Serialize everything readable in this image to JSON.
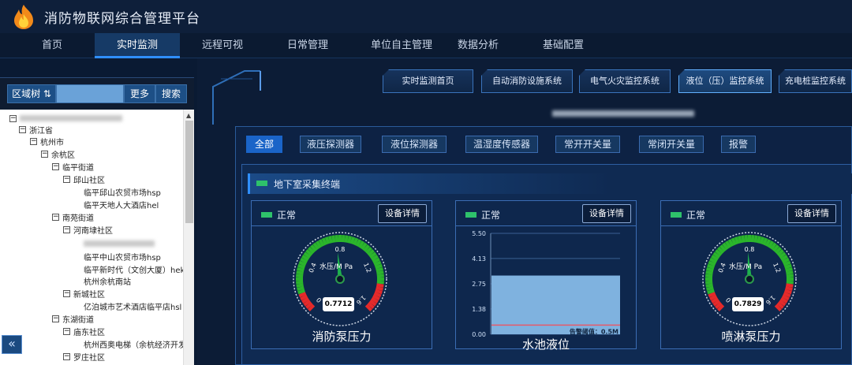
{
  "app": {
    "title": "消防物联网综合管理平台"
  },
  "nav": [
    {
      "label": "首页",
      "active": false
    },
    {
      "label": "实时监测",
      "active": true
    },
    {
      "label": "远程可视",
      "active": false
    },
    {
      "label": "日常管理",
      "active": false
    },
    {
      "label": "单位自主管理",
      "active": false
    },
    {
      "label": "数据分析",
      "active": false
    },
    {
      "label": "基础配置",
      "active": false
    }
  ],
  "tree": {
    "region_button": "区域树 ⇅",
    "more_button": "更多",
    "search_button": "搜索",
    "nodes": [
      {
        "label": "浙江省",
        "level": 1
      },
      {
        "label": "杭州市",
        "level": 2
      },
      {
        "label": "余杭区",
        "level": 3
      },
      {
        "label": "临平街道",
        "level": 4
      },
      {
        "label": "邱山社区",
        "level": 5
      },
      {
        "label": "临平邱山农贸市场hsp",
        "level": 6
      },
      {
        "label": "临平天地人大酒店hel",
        "level": 6
      },
      {
        "label": "南苑街道",
        "level": 4
      },
      {
        "label": "河南埭社区",
        "level": 5
      },
      {
        "label": "临平中山农贸市场hsp",
        "level": 6
      },
      {
        "label": "临平新时代（文创大厦）hek",
        "level": 6
      },
      {
        "label": "杭州余杭南站",
        "level": 6
      },
      {
        "label": "新城社区",
        "level": 5
      },
      {
        "label": "亿泊城市艺术酒店临平店hsl",
        "level": 6
      },
      {
        "label": "东湖街道",
        "level": 4
      },
      {
        "label": "庙东社区",
        "level": 5
      },
      {
        "label": "杭州西奥电梯（余杭经济开发区",
        "level": 6
      },
      {
        "label": "罗庄社区",
        "level": 5
      }
    ]
  },
  "systems": [
    {
      "label": "实时监测首页",
      "active": false
    },
    {
      "label": "自动消防设施系统",
      "active": false
    },
    {
      "label": "电气火灾监控系统",
      "active": false
    },
    {
      "label": "液位（压）监控系统",
      "active": true
    },
    {
      "label": "充电桩监控系统",
      "active": false
    }
  ],
  "filters": [
    {
      "label": "全部",
      "active": true
    },
    {
      "label": "液压探测器",
      "active": false
    },
    {
      "label": "液位探测器",
      "active": false
    },
    {
      "label": "温湿度传感器",
      "active": false
    },
    {
      "label": "常开开关量",
      "active": false
    },
    {
      "label": "常闭开关量",
      "active": false
    },
    {
      "label": "报警",
      "active": false
    }
  ],
  "section": {
    "title": "地下室采集终端"
  },
  "cards": [
    {
      "status": "正常",
      "detail_button": "设备详情",
      "kind": "gauge",
      "value": 0.7712,
      "value_text": "0.7712",
      "unit": "水压/M Pa",
      "ticks": [
        "0",
        "0.4",
        "0.8",
        "1.2",
        "1.6"
      ],
      "max": 1.6,
      "label": "消防泵压力"
    },
    {
      "status": "正常",
      "detail_button": "设备详情",
      "kind": "bar",
      "label": "水池液位",
      "y_ticks": [
        "5.50",
        "4.13",
        "2.75",
        "1.38",
        "0.00"
      ],
      "ylim": [
        0,
        5.5
      ],
      "value": 3.2,
      "threshold": 0.5,
      "threshold_label": "告警阈值：0.5M"
    },
    {
      "status": "正常",
      "detail_button": "设备详情",
      "kind": "gauge",
      "value": 0.7829,
      "value_text": "0.7829",
      "unit": "水压/M Pa",
      "ticks": [
        "0",
        "0.4",
        "0.8",
        "1.2",
        "1.6"
      ],
      "max": 1.6,
      "label": "喷淋泵压力"
    }
  ],
  "colors": {
    "accent": "#1a64c8",
    "status_ok": "#2ec26b",
    "gauge_green": "#2bb52b",
    "gauge_red": "#e52a2a",
    "bar_fill": "#7fb2df",
    "threshold_line": "#e65a6a"
  },
  "icons": {
    "logo": "flame-icon",
    "collapse": "double-chevron-left-icon"
  }
}
